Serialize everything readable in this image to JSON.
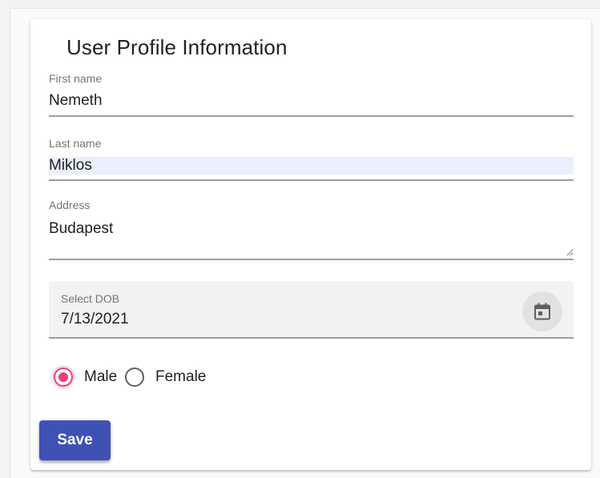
{
  "form": {
    "title": "User Profile Information",
    "first_name": {
      "label": "First name",
      "value": "Nemeth"
    },
    "last_name": {
      "label": "Last name",
      "value": "Miklos"
    },
    "address": {
      "label": "Address",
      "value": "Budapest"
    },
    "dob": {
      "label": "Select DOB",
      "value": "7/13/2021",
      "icon": "calendar-icon"
    },
    "gender": {
      "options": [
        {
          "label": "Male",
          "checked": true
        },
        {
          "label": "Female",
          "checked": false
        }
      ]
    },
    "save_label": "Save"
  },
  "colors": {
    "primary": "#3f51b5",
    "accent": "#ec407a",
    "autofill": "#e8f0fe"
  }
}
